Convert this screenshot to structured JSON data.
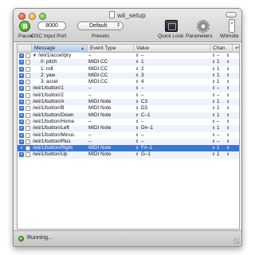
{
  "window": {
    "title": "wii_setup"
  },
  "toolbar": {
    "pause_label": "Pause",
    "port_value": "8000",
    "port_label": "OSC Input Port",
    "preset_value": "Default",
    "presets_label": "Presets",
    "quicklook_label": "Quick Look",
    "parameters_label": "Parameters",
    "wiimote_label": "Wiimote"
  },
  "table": {
    "headers": [
      "Message",
      "Event Type",
      "Value",
      "Chan."
    ],
    "sorted_column": "Message",
    "rows": [
      {
        "message": "/wii/1/accel/pry",
        "event": "–",
        "value": "–",
        "chan": "–",
        "type": "group"
      },
      {
        "message": "0: pitch",
        "event": "MIDI CC",
        "value": "1",
        "chan": "1",
        "type": "child"
      },
      {
        "message": "1: roll",
        "event": "MIDI CC",
        "value": "2",
        "chan": "1",
        "type": "child"
      },
      {
        "message": "2: yaw",
        "event": "MIDI CC",
        "value": "3",
        "chan": "1",
        "type": "child"
      },
      {
        "message": "3: accel",
        "event": "MIDI CC",
        "value": "4",
        "chan": "1",
        "type": "child"
      },
      {
        "message": "/wii/1/button/1",
        "event": "–",
        "value": "–",
        "chan": "–",
        "type": "row"
      },
      {
        "message": "/wii/1/button/2",
        "event": "–",
        "value": "–",
        "chan": "–",
        "type": "row"
      },
      {
        "message": "/wii/1/button/A",
        "event": "MIDI Note",
        "value": "C3",
        "chan": "1",
        "type": "row"
      },
      {
        "message": "/wii/1/button/B",
        "event": "MIDI Note",
        "value": "D3",
        "chan": "1",
        "type": "row"
      },
      {
        "message": "/wii/1/button/Down",
        "event": "MIDI Note",
        "value": "C–1",
        "chan": "1",
        "type": "row"
      },
      {
        "message": "/wii/1/button/Home",
        "event": "–",
        "value": "–",
        "chan": "–",
        "type": "row"
      },
      {
        "message": "/wii/1/button/Left",
        "event": "MIDI Note",
        "value": "D#–1",
        "chan": "1",
        "type": "row"
      },
      {
        "message": "/wii/1/button/Minus",
        "event": "–",
        "value": "–",
        "chan": "–",
        "type": "row"
      },
      {
        "message": "/wii/1/button/Plus",
        "event": "–",
        "value": "–",
        "chan": "–",
        "type": "row"
      },
      {
        "message": "/wii/1/button/Right",
        "event": "MIDI Note",
        "value": "F#–1",
        "chan": "1",
        "type": "selected"
      },
      {
        "message": "/wii/1/button/Up",
        "event": "MIDI Note",
        "value": "G–1",
        "chan": "1",
        "type": "row"
      }
    ]
  },
  "status": {
    "text": "Running..."
  },
  "colors": {
    "selection": "#3875d7",
    "alt_row": "#eef3fb",
    "status_green": "#2f9116"
  }
}
